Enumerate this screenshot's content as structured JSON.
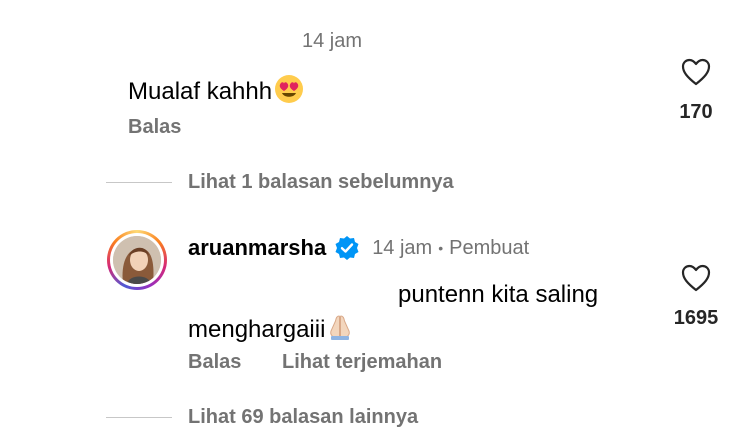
{
  "comment1": {
    "timestamp": "14 jam",
    "text": "Mualaf kahhh",
    "emoji": "heart-eyes-emoji",
    "reply_label": "Balas",
    "like_count": "170"
  },
  "thread1": {
    "view_previous": "Lihat 1 balasan sebelumnya"
  },
  "comment2": {
    "username": "aruanmarsha",
    "timestamp": "14 jam",
    "separator": "•",
    "author_badge": "Pembuat",
    "text_line1": "puntenn kita saling",
    "text_line2": "menghargaiii",
    "emoji": "folded-hands-emoji",
    "reply_label": "Balas",
    "translate_label": "Lihat terjemahan",
    "like_count": "1695"
  },
  "thread2": {
    "view_more": "Lihat 69 balasan lainnya"
  },
  "colors": {
    "muted": "#737373",
    "verified_blue": "#0095f6",
    "line": "#c7c7c7"
  }
}
